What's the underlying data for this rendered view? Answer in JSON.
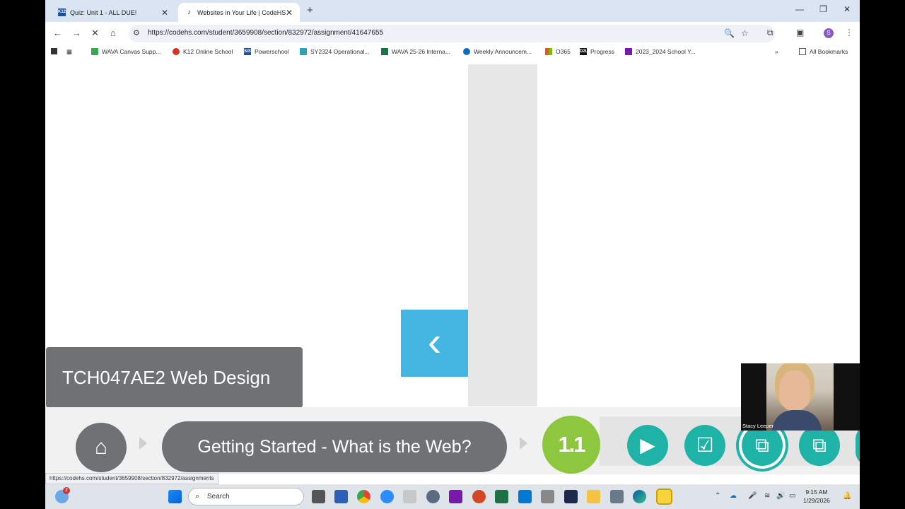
{
  "browser": {
    "tabs": [
      {
        "label": "Quiz: Unit 1 - ALL DUE!",
        "favicon": "K12",
        "active": false
      },
      {
        "label": "Websites in Your Life | CodeHS",
        "favicon": "♪",
        "active": true
      }
    ],
    "url": "https://codehs.com/student/3659908/section/832972/assignment/41647655",
    "profile_initial": "S",
    "bookmarks": [
      {
        "label": "WAVA Canvas Supp...",
        "color": "#3aa757"
      },
      {
        "label": "K12 Online School",
        "color": "#d93025"
      },
      {
        "label": "Powerschool",
        "color": "#1d4f9f",
        "favicon_text": "SIS"
      },
      {
        "label": "SY2324 Operational...",
        "color": "#2ba3b8"
      },
      {
        "label": "WAVA 25-26 Interna...",
        "color": "#1e7145"
      },
      {
        "label": "Weekly Announcem...",
        "color": "#0f6cbd"
      },
      {
        "label": "O365",
        "color": "#f25022"
      },
      {
        "label": "Progress",
        "color": "#111111",
        "favicon_text": "D2L"
      },
      {
        "label": "2023_2024 School Y...",
        "color": "#7719aa"
      }
    ],
    "all_bookmarks_label": "All Bookmarks"
  },
  "page": {
    "course_title": "TCH047AE2 Web Design",
    "lesson_title": "Getting Started - What is the Web?",
    "lesson_number": "1.1",
    "status_url": "https://codehs.com/student/3659908/section/832972/assignments"
  },
  "webcam": {
    "name": "Stacy Leeper"
  },
  "taskbar": {
    "search_placeholder": "Search",
    "weather_badge": "2",
    "time": "9:15 AM",
    "date": "1/29/2026"
  },
  "colors": {
    "lesson_number_bg": "#8dc63f",
    "activity_bg": "#1eb3a6",
    "prev_arrow_bg": "#45b5e2",
    "pill_bg": "#6e7275"
  }
}
